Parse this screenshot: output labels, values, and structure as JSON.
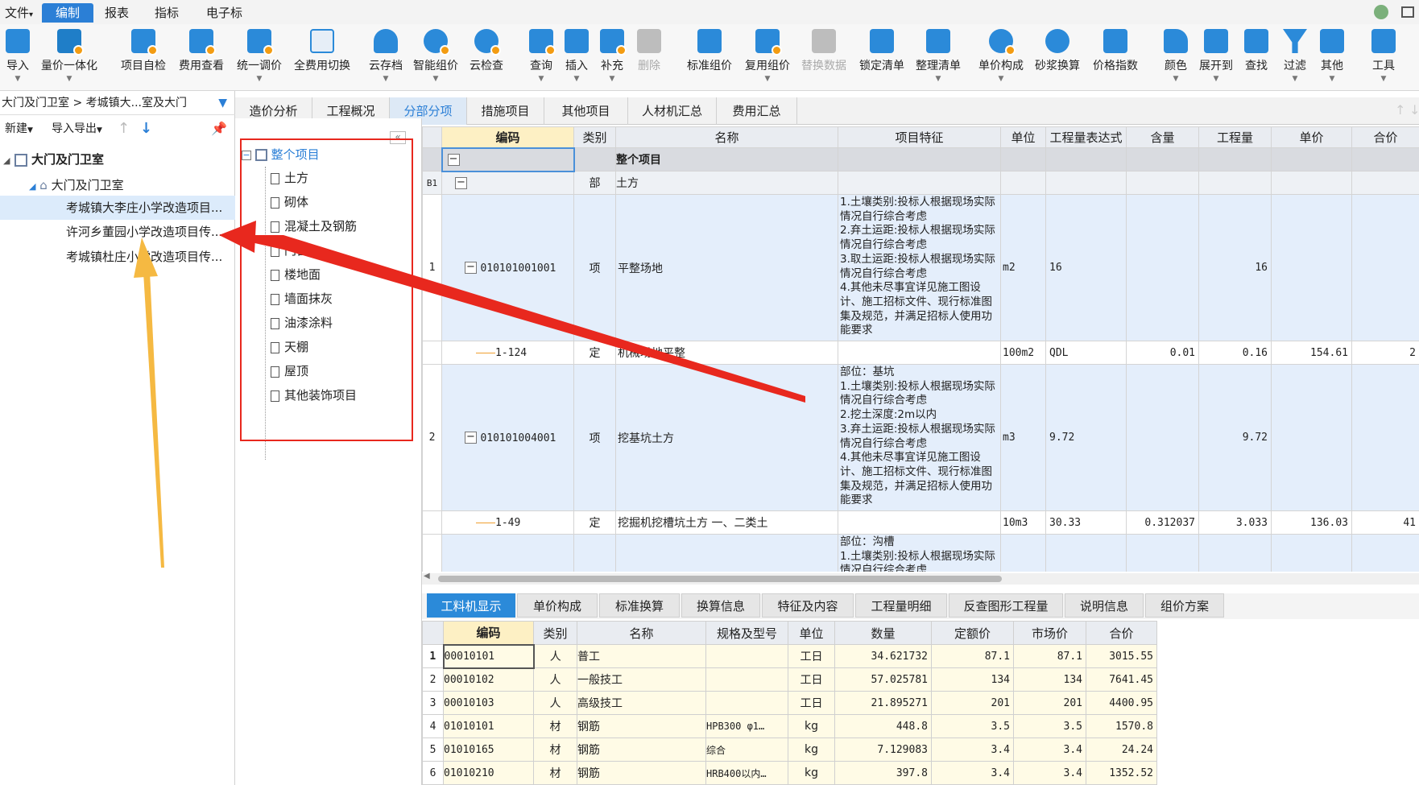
{
  "menubar": {
    "items": [
      {
        "label": "文件",
        "caret": "▾"
      },
      {
        "label": "编制"
      },
      {
        "label": "报表"
      },
      {
        "label": "指标"
      },
      {
        "label": "电子标"
      }
    ]
  },
  "toolbar": {
    "buttons": [
      {
        "label": "导入"
      },
      {
        "label": "量价一体化"
      },
      {
        "label": "项目自检"
      },
      {
        "label": "费用查看"
      },
      {
        "label": "统一调价"
      },
      {
        "label": "全费用切换"
      },
      {
        "label": "云存档"
      },
      {
        "label": "智能组价"
      },
      {
        "label": "云检查"
      },
      {
        "label": "查询"
      },
      {
        "label": "插入"
      },
      {
        "label": "补充"
      },
      {
        "label": "删除"
      },
      {
        "label": "标准组价"
      },
      {
        "label": "复用组价"
      },
      {
        "label": "替换数据"
      },
      {
        "label": "锁定清单"
      },
      {
        "label": "整理清单"
      },
      {
        "label": "单价构成"
      },
      {
        "label": "砂浆换算"
      },
      {
        "label": "价格指数"
      },
      {
        "label": "颜色"
      },
      {
        "label": "展开到"
      },
      {
        "label": "查找"
      },
      {
        "label": "过滤"
      },
      {
        "label": "其他"
      },
      {
        "label": "工具"
      }
    ]
  },
  "left": {
    "breadcrumb": "大门及门卫室 > 考城镇大...室及大门",
    "new_label": "新建",
    "import_export_label": "导入导出",
    "tree": [
      {
        "label": "大门及门卫室"
      },
      {
        "label": "大门及门卫室"
      },
      {
        "label": "考城镇大李庄小学改造项目..."
      },
      {
        "label": "许河乡董园小学改造项目传..."
      },
      {
        "label": "考城镇杜庄小学改造项目传..."
      }
    ]
  },
  "tabs": [
    {
      "label": "造价分析"
    },
    {
      "label": "工程概况"
    },
    {
      "label": "分部分项"
    },
    {
      "label": "措施项目"
    },
    {
      "label": "其他项目"
    },
    {
      "label": "人材机汇总"
    },
    {
      "label": "费用汇总"
    }
  ],
  "midtree": {
    "collapse_label": "«",
    "root": "整个项目",
    "items": [
      {
        "label": "土方"
      },
      {
        "label": "砌体"
      },
      {
        "label": "混凝土及钢筋"
      },
      {
        "label": "门窗"
      },
      {
        "label": "楼地面"
      },
      {
        "label": "墙面抹灰"
      },
      {
        "label": "油漆涂料"
      },
      {
        "label": "天棚"
      },
      {
        "label": "屋顶"
      },
      {
        "label": "其他装饰项目"
      }
    ]
  },
  "grid": {
    "headers": [
      "编码",
      "类别",
      "名称",
      "项目特征",
      "单位",
      "工程量表达式",
      "含量",
      "工程量",
      "单价",
      "合价"
    ],
    "root_label": "整个项目",
    "section": {
      "idx": "B1",
      "type": "部",
      "name": "土方"
    },
    "rows": [
      {
        "idx": "1",
        "code": "010101001001",
        "type": "项",
        "name": "平整场地",
        "feature": "1.土壤类别:投标人根据现场实际情况自行综合考虑\n2.弃土运距:投标人根据现场实际情况自行综合考虑\n3.取土运距:投标人根据现场实际情况自行综合考虑\n4.其他未尽事宜详见施工图设计、施工招标文件、现行标准图集及规范，并满足招标人使用功能要求",
        "unit": "m2",
        "expr": "16",
        "content": "",
        "qty": "16",
        "price": "",
        "total": ""
      },
      {
        "idx": "",
        "code": "1-124",
        "type": "定",
        "name": "机械场地平整",
        "feature": "",
        "unit": "100m2",
        "expr": "QDL",
        "content": "0.01",
        "qty": "0.16",
        "price": "154.61",
        "total": "2"
      },
      {
        "idx": "2",
        "code": "010101004001",
        "type": "项",
        "name": "挖基坑土方",
        "feature": "部位：基坑\n1.土壤类别:投标人根据现场实际情况自行综合考虑\n2.挖土深度:2m以内\n3.弃土运距:投标人根据现场实际情况自行综合考虑\n4.其他未尽事宜详见施工图设计、施工招标文件、现行标准图集及规范，并满足招标人使用功能要求",
        "unit": "m3",
        "expr": "9.72",
        "content": "",
        "qty": "9.72",
        "price": "",
        "total": ""
      },
      {
        "idx": "",
        "code": "1-49",
        "type": "定",
        "name": "挖掘机挖槽坑土方 一、二类土",
        "feature": "",
        "unit": "10m3",
        "expr": "30.33",
        "content": "0.312037",
        "qty": "3.033",
        "price": "136.03",
        "total": "41"
      },
      {
        "idx": "",
        "code": "",
        "type": "",
        "name": "",
        "feature": "部位：沟槽\n1.土壤类别:投标人根据现场实际情况自行综合考虑",
        "unit": "",
        "expr": "",
        "content": "",
        "qty": "",
        "price": "",
        "total": ""
      }
    ]
  },
  "bottom": {
    "tabs": [
      {
        "label": "工料机显示"
      },
      {
        "label": "单价构成"
      },
      {
        "label": "标准换算"
      },
      {
        "label": "换算信息"
      },
      {
        "label": "特征及内容"
      },
      {
        "label": "工程量明细"
      },
      {
        "label": "反查图形工程量"
      },
      {
        "label": "说明信息"
      },
      {
        "label": "组价方案"
      }
    ],
    "headers": [
      "编码",
      "类别",
      "名称",
      "规格及型号",
      "单位",
      "数量",
      "定额价",
      "市场价",
      "合价"
    ],
    "rows": [
      {
        "idx": "1",
        "code": "00010101",
        "type": "人",
        "name": "普工",
        "spec": "",
        "unit": "工日",
        "qty": "34.621732",
        "quota": "87.1",
        "market": "87.1",
        "total": "3015.55"
      },
      {
        "idx": "2",
        "code": "00010102",
        "type": "人",
        "name": "一般技工",
        "spec": "",
        "unit": "工日",
        "qty": "57.025781",
        "quota": "134",
        "market": "134",
        "total": "7641.45"
      },
      {
        "idx": "3",
        "code": "00010103",
        "type": "人",
        "name": "高级技工",
        "spec": "",
        "unit": "工日",
        "qty": "21.895271",
        "quota": "201",
        "market": "201",
        "total": "4400.95"
      },
      {
        "idx": "4",
        "code": "01010101",
        "type": "材",
        "name": "钢筋",
        "spec": "HPB300 φ1…",
        "unit": "kg",
        "qty": "448.8",
        "quota": "3.5",
        "market": "3.5",
        "total": "1570.8"
      },
      {
        "idx": "5",
        "code": "01010165",
        "type": "材",
        "name": "钢筋",
        "spec": "综合",
        "unit": "kg",
        "qty": "7.129083",
        "quota": "3.4",
        "market": "3.4",
        "total": "24.24"
      },
      {
        "idx": "6",
        "code": "01010210",
        "type": "材",
        "name": "钢筋",
        "spec": "HRB400以内…",
        "unit": "kg",
        "qty": "397.8",
        "quota": "3.4",
        "market": "3.4",
        "total": "1352.52"
      }
    ]
  },
  "colors": {
    "accent": "#2b7fd6",
    "annotation_red": "#e8281e",
    "annotation_yellow": "#f5b942"
  }
}
